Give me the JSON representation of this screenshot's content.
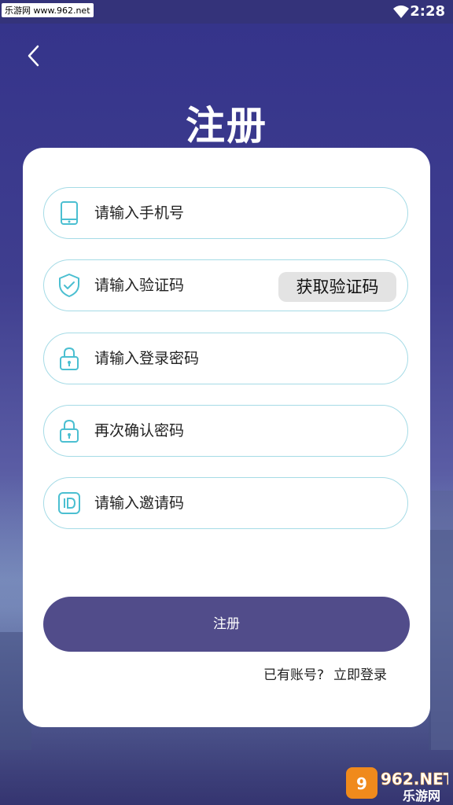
{
  "status_bar": {
    "watermark": "乐游网 www.962.net",
    "time": "2:28"
  },
  "page": {
    "title": "注册"
  },
  "form": {
    "phone_placeholder": "请输入手机号",
    "code_placeholder": "请输入验证码",
    "get_code_label": "获取验证码",
    "password_placeholder": "请输入登录密码",
    "confirm_placeholder": "再次确认密码",
    "invite_placeholder": "请输入邀请码",
    "submit_label": "注册"
  },
  "footer": {
    "have_account": "已有账号?",
    "login_link": "立即登录"
  },
  "watermark_bottom": {
    "brand": "962.NET",
    "sub": "乐游网"
  },
  "colors": {
    "accent_teal": "#4bbfd1",
    "button_purple": "#514c8a",
    "border": "#a5dbe6"
  }
}
